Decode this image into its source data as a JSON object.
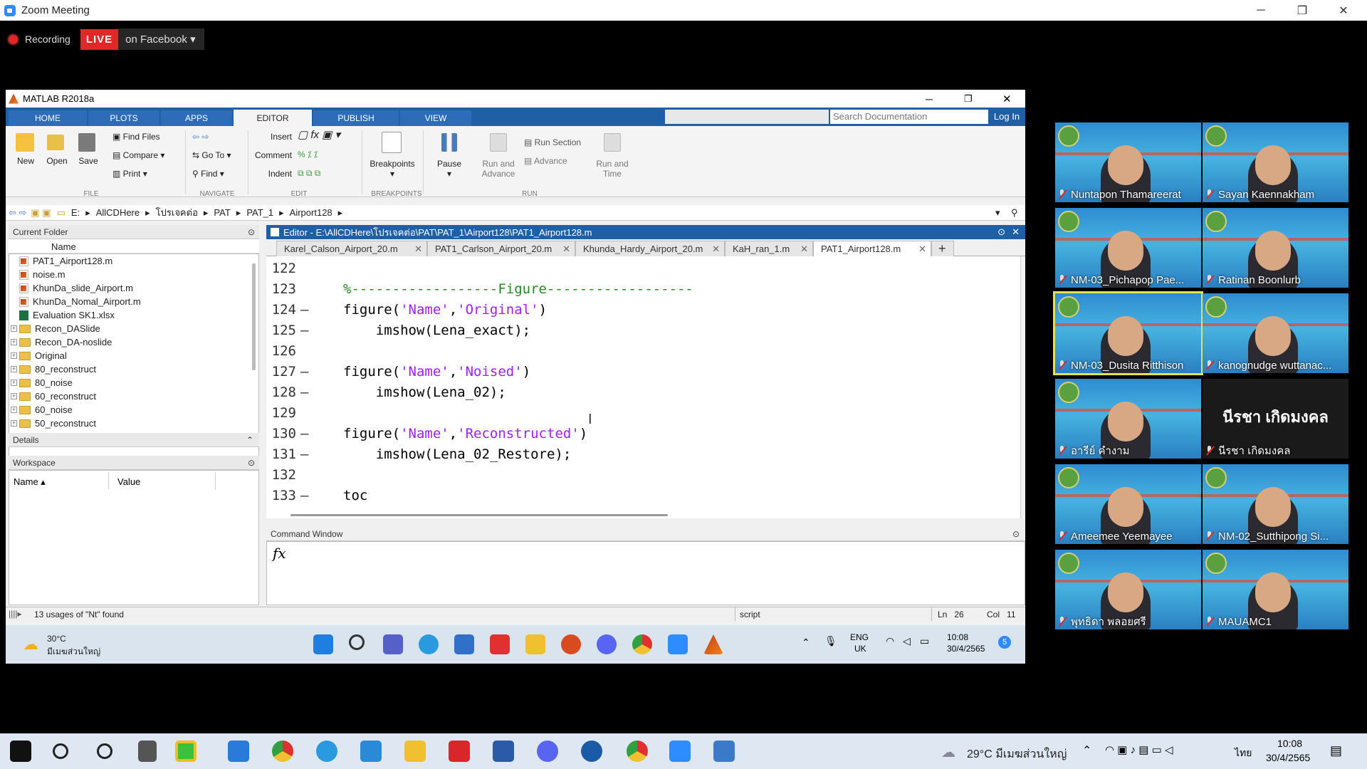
{
  "zoom": {
    "title": "Zoom Meeting",
    "recording": "Recording",
    "live": "LIVE",
    "live_dest": "on Facebook"
  },
  "matlab": {
    "title": "MATLAB R2018a",
    "tabs": [
      "HOME",
      "PLOTS",
      "APPS",
      "EDITOR",
      "PUBLISH",
      "VIEW"
    ],
    "active_tab": "EDITOR",
    "search_placeholder": "Search Documentation",
    "login": "Log In",
    "toolstrip": {
      "new": "New",
      "open": "Open",
      "save": "Save",
      "find_files": "Find Files",
      "compare": "Compare",
      "print": "Print",
      "go_to": "Go To",
      "find": "Find",
      "insert": "Insert",
      "comment": "Comment",
      "indent": "Indent",
      "breakpoints": "Breakpoints",
      "pause": "Pause",
      "run_advance": "Run and Advance",
      "run_section": "Run Section",
      "advance": "Advance",
      "run_time": "Run and Time",
      "groups": [
        "FILE",
        "NAVIGATE",
        "EDIT",
        "BREAKPOINTS",
        "RUN"
      ]
    },
    "address": [
      "E:",
      "AllCDHere",
      "โปรเจคต่อ",
      "PAT",
      "PAT_1",
      "Airport128"
    ],
    "current_folder": {
      "header": "Current Folder",
      "col_name": "Name",
      "items": [
        {
          "name": "PAT1_Airport128.m",
          "type": "m",
          "expand": false
        },
        {
          "name": "noise.m",
          "type": "m",
          "expand": false
        },
        {
          "name": "KhunDa_slide_Airport.m",
          "type": "m",
          "expand": false
        },
        {
          "name": "KhunDa_Nomal_Airport.m",
          "type": "m",
          "expand": false
        },
        {
          "name": "Evaluation SK1.xlsx",
          "type": "x",
          "expand": false
        },
        {
          "name": "Recon_DASlide",
          "type": "d",
          "expand": true
        },
        {
          "name": "Recon_DA-noslide",
          "type": "d",
          "expand": true
        },
        {
          "name": "Original",
          "type": "d",
          "expand": true
        },
        {
          "name": "80_reconstruct",
          "type": "d",
          "expand": true
        },
        {
          "name": "80_noise",
          "type": "d",
          "expand": true
        },
        {
          "name": "60_reconstruct",
          "type": "d",
          "expand": true
        },
        {
          "name": "60_noise",
          "type": "d",
          "expand": true
        },
        {
          "name": "50_reconstruct",
          "type": "d",
          "expand": true
        }
      ]
    },
    "details": "Details",
    "workspace": {
      "header": "Workspace",
      "col_name": "Name",
      "col_value": "Value"
    },
    "editor": {
      "title": "Editor - E:\\AllCDHere\\โปรเจคต่อ\\PAT\\PAT_1\\Airport128\\PAT1_Airport128.m",
      "tabs": [
        "Karel_Calson_Airport_20.m",
        "PAT1_Carlson_Airport_20.m",
        "Khunda_Hardy_Airport_20.m",
        "KaH_ran_1.m",
        "PAT1_Airport128.m"
      ],
      "active_tab": "PAT1_Airport128.m",
      "lines": [
        {
          "n": "122",
          "dash": "",
          "parts": [
            {
              "t": "",
              "c": ""
            }
          ]
        },
        {
          "n": "123",
          "dash": "",
          "parts": [
            {
              "t": "%------------------Figure------------------",
              "c": "cmt"
            }
          ]
        },
        {
          "n": "124",
          "dash": "—",
          "parts": [
            {
              "t": "figure(",
              "c": ""
            },
            {
              "t": "'Name'",
              "c": "str"
            },
            {
              "t": ",",
              "c": ""
            },
            {
              "t": "'Original'",
              "c": "str"
            },
            {
              "t": ")",
              "c": ""
            }
          ]
        },
        {
          "n": "125",
          "dash": "—",
          "parts": [
            {
              "t": "    imshow(Lena_exact);",
              "c": ""
            }
          ]
        },
        {
          "n": "126",
          "dash": "",
          "parts": [
            {
              "t": "",
              "c": ""
            }
          ]
        },
        {
          "n": "127",
          "dash": "—",
          "parts": [
            {
              "t": "figure(",
              "c": ""
            },
            {
              "t": "'Name'",
              "c": "str"
            },
            {
              "t": ",",
              "c": ""
            },
            {
              "t": "'Noised'",
              "c": "str"
            },
            {
              "t": ")",
              "c": ""
            }
          ]
        },
        {
          "n": "128",
          "dash": "—",
          "parts": [
            {
              "t": "    imshow(Lena_02);",
              "c": ""
            }
          ]
        },
        {
          "n": "129",
          "dash": "",
          "parts": [
            {
              "t": "",
              "c": ""
            }
          ]
        },
        {
          "n": "130",
          "dash": "—",
          "parts": [
            {
              "t": "figure(",
              "c": ""
            },
            {
              "t": "'Name'",
              "c": "str"
            },
            {
              "t": ",",
              "c": ""
            },
            {
              "t": "'Reconstructed'",
              "c": "str"
            },
            {
              "t": ")",
              "c": ""
            }
          ]
        },
        {
          "n": "131",
          "dash": "—",
          "parts": [
            {
              "t": "    imshow(Lena_02_Restore);",
              "c": ""
            }
          ]
        },
        {
          "n": "132",
          "dash": "",
          "parts": [
            {
              "t": "",
              "c": ""
            }
          ]
        },
        {
          "n": "133",
          "dash": "—",
          "parts": [
            {
              "t": "toc",
              "c": ""
            }
          ]
        }
      ]
    },
    "command_window": {
      "header": "Command Window",
      "prompt": "fx"
    },
    "status": {
      "message": "13 usages of \"Nt\" found",
      "mode": "script",
      "ln_label": "Ln",
      "ln": "26",
      "col_label": "Col",
      "col": "11"
    }
  },
  "win_taskbar": {
    "temp": "30°C",
    "weather": "มีเมฆส่วนใหญ่",
    "lang1": "ENG",
    "lang2": "UK",
    "time": "10:08",
    "date": "30/4/2565",
    "notif": "5"
  },
  "os_taskbar": {
    "temp": "29°C",
    "weather": "มีเมฆส่วนใหญ่",
    "lang": "ไทย",
    "time": "10:08",
    "date": "30/4/2565"
  },
  "participants": [
    {
      "name": "Nuntapon Thamareerat",
      "video": true,
      "active": false
    },
    {
      "name": "Sayan Kaennakham",
      "video": true,
      "active": false
    },
    {
      "name": "NM-03_Pichapop Pae...",
      "video": true,
      "active": false
    },
    {
      "name": "Ratinan Boonlurb",
      "video": true,
      "active": false
    },
    {
      "name": "NM-03_Dusita Ritthison",
      "video": true,
      "active": true
    },
    {
      "name": "kanognudge wuttanac...",
      "video": true,
      "active": false
    },
    {
      "name": "อารีย์ คำงาม",
      "video": true,
      "active": false
    },
    {
      "name": "นีรชา เกิดมงคล",
      "video": false,
      "big": "นีรชา เกิดมงคล",
      "active": false
    },
    {
      "name": "Ameemee Yeemayee",
      "video": true,
      "active": false
    },
    {
      "name": "NM-02_Sutthipong Si...",
      "video": true,
      "active": false
    },
    {
      "name": "พุทธิดา พลอยศรี",
      "video": true,
      "active": false
    },
    {
      "name": "MAUAMC1",
      "video": true,
      "active": false
    }
  ]
}
